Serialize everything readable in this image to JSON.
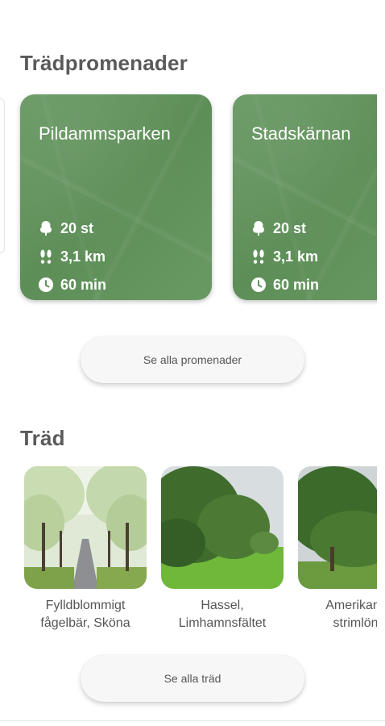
{
  "walks": {
    "title": "Trädpromenader",
    "cards": [
      {
        "name": "Pildammsparken",
        "trees": "20 st",
        "distance": "3,1 km",
        "time": "60 min"
      },
      {
        "name": "Stadskärnan",
        "trees": "20 st",
        "distance": "3,1 km",
        "time": "60 min"
      }
    ],
    "see_all_label": "Se alla promenader",
    "icons": {
      "trees": "tree-icon",
      "distance": "footprints-icon",
      "time": "clock-icon"
    },
    "card_color": "#639360"
  },
  "trees": {
    "title": "Träd",
    "items": [
      {
        "label": "Fylldblommigt fågelbär, Sköna"
      },
      {
        "label": "Hassel, Limhamnsfältet"
      },
      {
        "label": "Amerikansk strimlönn"
      }
    ],
    "see_all_label": "Se alla träd"
  }
}
